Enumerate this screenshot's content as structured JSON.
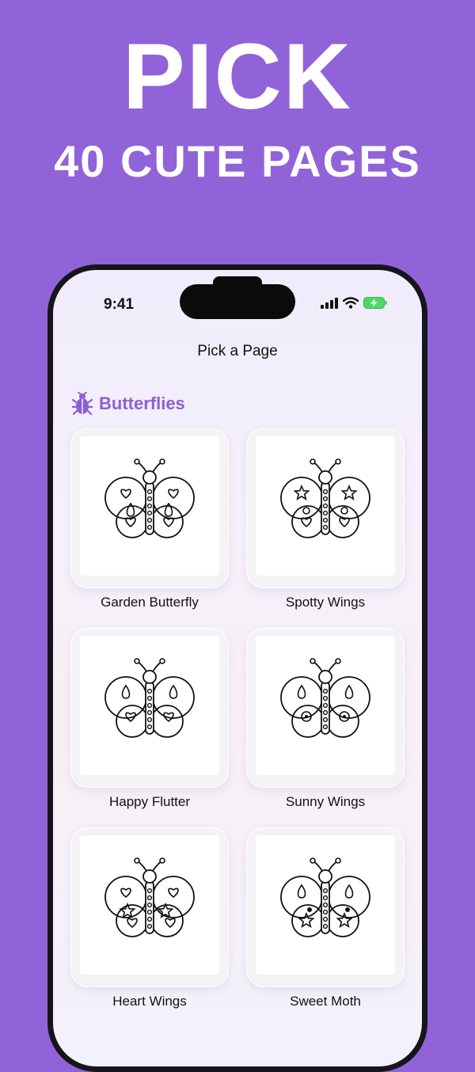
{
  "headline": {
    "line1": "PICK",
    "line2": "40 CUTE PAGES"
  },
  "status_bar": {
    "time": "9:41"
  },
  "nav": {
    "title": "Pick a Page"
  },
  "section": {
    "title": "Butterflies",
    "icon": "bug-icon",
    "color": "#8e5fd4"
  },
  "pages": [
    {
      "title": "Garden Butterfly",
      "upper": "heart",
      "lower": "drop-heart"
    },
    {
      "title": "Spotty Wings",
      "upper": "star",
      "lower": "heart-dots"
    },
    {
      "title": "Happy Flutter",
      "upper": "drop",
      "lower": "heart"
    },
    {
      "title": "Sunny Wings",
      "upper": "drop",
      "lower": "circle-dot"
    },
    {
      "title": "Heart Wings",
      "upper": "heart",
      "lower": "star-heart"
    },
    {
      "title": "Sweet Moth",
      "upper": "drop",
      "lower": "star-dot"
    }
  ],
  "colors": {
    "background": "#9163d8",
    "accent": "#8e5fd4"
  }
}
